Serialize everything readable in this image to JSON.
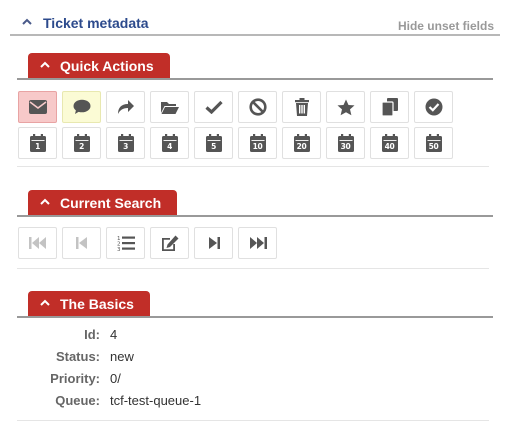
{
  "metadata": {
    "title": "Ticket metadata",
    "hide_unset": "Hide unset fields"
  },
  "sections": {
    "quick_actions": {
      "title": "Quick Actions"
    },
    "current_search": {
      "title": "Current Search"
    },
    "basics": {
      "title": "The Basics"
    }
  },
  "quick_actions": {
    "row1": [
      {
        "icon": "envelope-icon",
        "state": "active-red"
      },
      {
        "icon": "comment-icon",
        "state": "active-yellow"
      },
      {
        "icon": "forward-arrow-icon"
      },
      {
        "icon": "folder-open-icon"
      },
      {
        "icon": "checkmark-icon"
      },
      {
        "icon": "ban-icon"
      },
      {
        "icon": "trash-icon"
      },
      {
        "icon": "star-icon"
      },
      {
        "icon": "copy-icon"
      },
      {
        "icon": "check-circle-icon"
      }
    ],
    "row2_days": [
      "1",
      "2",
      "3",
      "4",
      "5",
      "10",
      "20",
      "30",
      "40",
      "50"
    ]
  },
  "current_search": {
    "buttons": [
      {
        "icon": "first-page-icon",
        "disabled": true
      },
      {
        "icon": "previous-page-icon",
        "disabled": true
      },
      {
        "icon": "numbered-list-icon"
      },
      {
        "icon": "edit-icon"
      },
      {
        "icon": "next-page-icon"
      },
      {
        "icon": "last-page-icon"
      }
    ]
  },
  "basics": {
    "fields": [
      {
        "label": "Id:",
        "value": "4"
      },
      {
        "label": "Status:",
        "value": "new"
      },
      {
        "label": "Priority:",
        "value": "0/"
      },
      {
        "label": "Queue:",
        "value": "tcf-test-queue-1"
      }
    ]
  }
}
